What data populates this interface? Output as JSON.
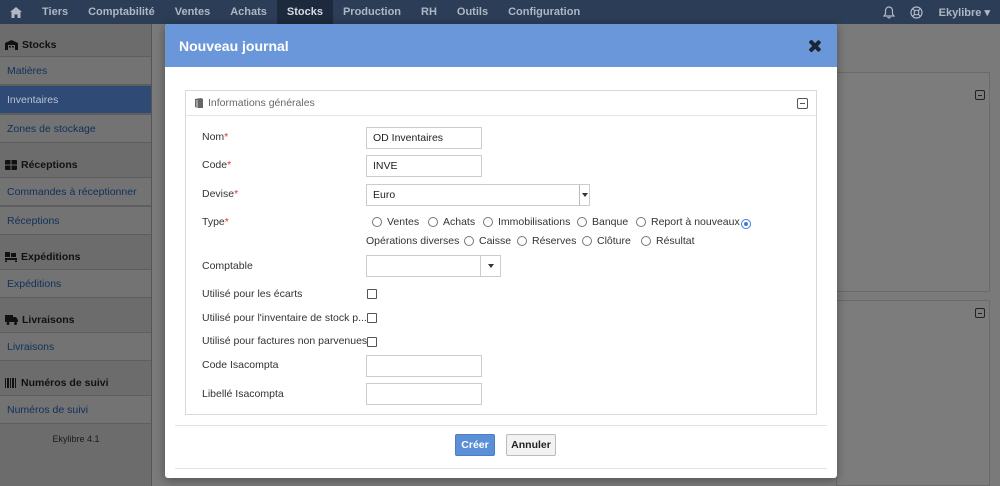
{
  "topnav": {
    "items": [
      "Tiers",
      "Comptabilité",
      "Ventes",
      "Achats",
      "Stocks",
      "Production",
      "RH",
      "Outils",
      "Configuration"
    ],
    "active": "Stocks",
    "user": "Ekylibre ▾"
  },
  "sidebar": {
    "sections": [
      {
        "title": "Stocks",
        "items": [
          "Matières",
          "Inventaires",
          "Zones de stockage"
        ]
      },
      {
        "title": "Réceptions",
        "items": [
          "Commandes à réceptionner",
          "Réceptions"
        ]
      },
      {
        "title": "Expéditions",
        "items": [
          "Expéditions"
        ]
      },
      {
        "title": "Livraisons",
        "items": [
          "Livraisons"
        ]
      },
      {
        "title": "Numéros de suivi",
        "items": [
          "Numéros de suivi"
        ]
      }
    ],
    "active_item": "Inventaires",
    "version": "Ekylibre 4.1"
  },
  "modal": {
    "title": "Nouveau journal",
    "fieldset_title": "Informations générales",
    "fields": {
      "nom": {
        "label": "Nom",
        "value": "OD Inventaires"
      },
      "code": {
        "label": "Code",
        "value": "INVE"
      },
      "devise": {
        "label": "Devise",
        "value": "Euro"
      },
      "type": {
        "label": "Type"
      },
      "comptable": {
        "label": "Comptable",
        "value": ""
      },
      "ecarts": {
        "label": "Utilisé pour les écarts"
      },
      "inventaire": {
        "label": "Utilisé pour l'inventaire de stock p..."
      },
      "factures": {
        "label": "Utilisé pour factures non parvenues"
      },
      "code_isacompta": {
        "label": "Code Isacompta",
        "value": ""
      },
      "libelle_isacompta": {
        "label": "Libellé Isacompta",
        "value": ""
      }
    },
    "type_options_row1": [
      "Ventes",
      "Achats",
      "Immobilisations",
      "Banque",
      "Report à nouveaux"
    ],
    "type_options_row2": [
      "Opérations diverses",
      "Caisse",
      "Réserves",
      "Clôture",
      "Résultat"
    ],
    "type_selected": "Opérations diverses",
    "required_mark": "*",
    "buttons": {
      "create": "Créer",
      "cancel": "Annuler"
    }
  }
}
